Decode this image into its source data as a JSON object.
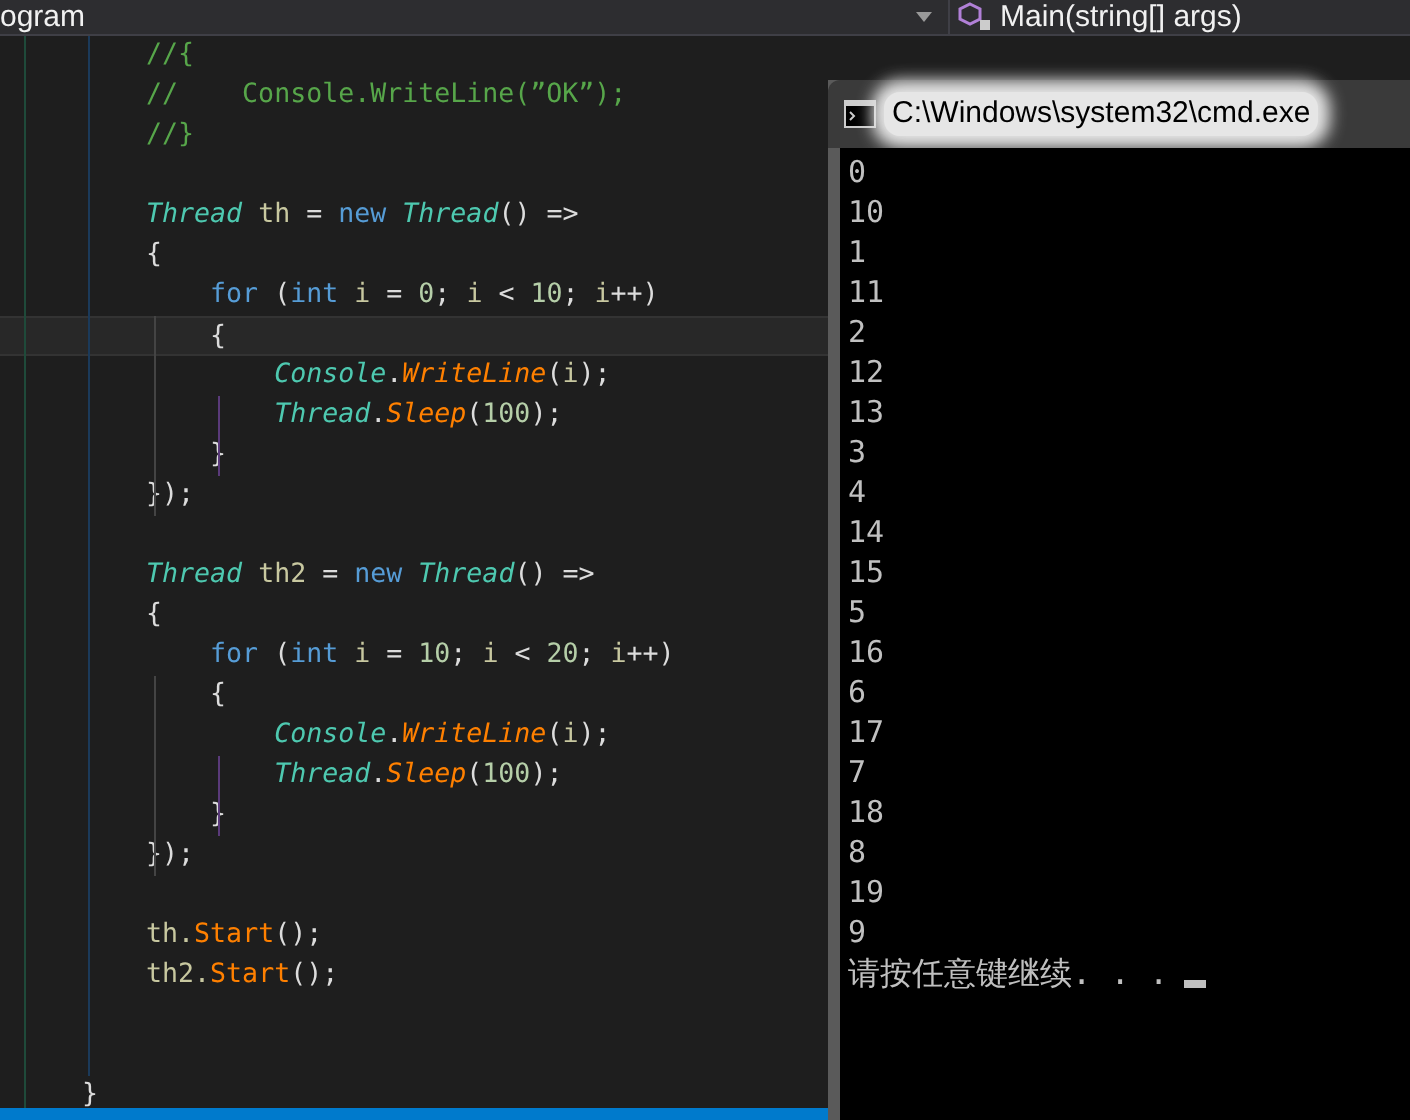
{
  "tab_bar": {
    "file_dropdown": "ogram",
    "member_dropdown": "Main(string[] args)"
  },
  "code_lines": [
    {
      "current": false,
      "tokens": [
        {
          "kind": "comment",
          "text": "    //{"
        }
      ]
    },
    {
      "current": false,
      "tokens": [
        {
          "kind": "comment",
          "text": "    //    Console.WriteLine(”OK”);"
        }
      ]
    },
    {
      "current": false,
      "tokens": [
        {
          "kind": "comment",
          "text": "    //}"
        }
      ]
    },
    {
      "current": false
    },
    {
      "current": false,
      "tokens": [
        {
          "kind": "type",
          "text": "    Thread"
        },
        {
          "kind": "var",
          "text": " th"
        },
        {
          "kind": "plain",
          "text": " = "
        },
        {
          "kind": "keyword",
          "text": "new"
        },
        {
          "kind": "type",
          "text": " Thread"
        },
        {
          "kind": "plain",
          "text": "() =>"
        }
      ]
    },
    {
      "current": false,
      "tokens": [
        {
          "kind": "plain",
          "text": "    {"
        }
      ]
    },
    {
      "current": false,
      "tokens": [
        {
          "kind": "keyword",
          "text": "        for"
        },
        {
          "kind": "plain",
          "text": " ("
        },
        {
          "kind": "keyword",
          "text": "int"
        },
        {
          "kind": "var",
          "text": " i"
        },
        {
          "kind": "plain",
          "text": " = "
        },
        {
          "kind": "number",
          "text": "0"
        },
        {
          "kind": "plain",
          "text": "; "
        },
        {
          "kind": "var",
          "text": "i"
        },
        {
          "kind": "plain",
          "text": " < "
        },
        {
          "kind": "number",
          "text": "10"
        },
        {
          "kind": "plain",
          "text": "; "
        },
        {
          "kind": "var",
          "text": "i"
        },
        {
          "kind": "plain",
          "text": "++)"
        }
      ]
    },
    {
      "current": true,
      "tokens": [
        {
          "kind": "plain",
          "text": "        {"
        }
      ]
    },
    {
      "current": false,
      "tokens": [
        {
          "kind": "type",
          "text": "            Console"
        },
        {
          "kind": "plain",
          "text": "."
        },
        {
          "kind": "method",
          "text": "WriteLine"
        },
        {
          "kind": "plain",
          "text": "("
        },
        {
          "kind": "var",
          "text": "i"
        },
        {
          "kind": "plain",
          "text": ");"
        }
      ]
    },
    {
      "current": false,
      "tokens": [
        {
          "kind": "type",
          "text": "            Thread"
        },
        {
          "kind": "plain",
          "text": "."
        },
        {
          "kind": "method",
          "text": "Sleep"
        },
        {
          "kind": "plain",
          "text": "("
        },
        {
          "kind": "number",
          "text": "100"
        },
        {
          "kind": "plain",
          "text": ");"
        }
      ]
    },
    {
      "current": false,
      "tokens": [
        {
          "kind": "plain",
          "text": "        }"
        }
      ]
    },
    {
      "current": false,
      "tokens": [
        {
          "kind": "plain",
          "text": "    });"
        }
      ]
    },
    {
      "current": false
    },
    {
      "current": false,
      "tokens": [
        {
          "kind": "type",
          "text": "    Thread"
        },
        {
          "kind": "var",
          "text": " th2"
        },
        {
          "kind": "plain",
          "text": " = "
        },
        {
          "kind": "keyword",
          "text": "new"
        },
        {
          "kind": "type",
          "text": " Thread"
        },
        {
          "kind": "plain",
          "text": "() =>"
        }
      ]
    },
    {
      "current": false,
      "tokens": [
        {
          "kind": "plain",
          "text": "    {"
        }
      ]
    },
    {
      "current": false,
      "tokens": [
        {
          "kind": "keyword",
          "text": "        for"
        },
        {
          "kind": "plain",
          "text": " ("
        },
        {
          "kind": "keyword",
          "text": "int"
        },
        {
          "kind": "var",
          "text": " i"
        },
        {
          "kind": "plain",
          "text": " = "
        },
        {
          "kind": "number",
          "text": "10"
        },
        {
          "kind": "plain",
          "text": "; "
        },
        {
          "kind": "var",
          "text": "i"
        },
        {
          "kind": "plain",
          "text": " < "
        },
        {
          "kind": "number",
          "text": "20"
        },
        {
          "kind": "plain",
          "text": "; "
        },
        {
          "kind": "var",
          "text": "i"
        },
        {
          "kind": "plain",
          "text": "++)"
        }
      ]
    },
    {
      "current": false,
      "tokens": [
        {
          "kind": "plain",
          "text": "        {"
        }
      ]
    },
    {
      "current": false,
      "tokens": [
        {
          "kind": "type",
          "text": "            Console"
        },
        {
          "kind": "plain",
          "text": "."
        },
        {
          "kind": "method",
          "text": "WriteLine"
        },
        {
          "kind": "plain",
          "text": "("
        },
        {
          "kind": "var",
          "text": "i"
        },
        {
          "kind": "plain",
          "text": ");"
        }
      ]
    },
    {
      "current": false,
      "tokens": [
        {
          "kind": "type",
          "text": "            Thread"
        },
        {
          "kind": "plain",
          "text": "."
        },
        {
          "kind": "method",
          "text": "Sleep"
        },
        {
          "kind": "plain",
          "text": "("
        },
        {
          "kind": "number",
          "text": "100"
        },
        {
          "kind": "plain",
          "text": ");"
        }
      ]
    },
    {
      "current": false,
      "tokens": [
        {
          "kind": "plain",
          "text": "        }"
        }
      ]
    },
    {
      "current": false,
      "tokens": [
        {
          "kind": "plain",
          "text": "    });"
        }
      ]
    },
    {
      "current": false
    },
    {
      "current": false,
      "tokens": [
        {
          "kind": "var",
          "text": "    th."
        },
        {
          "kind": "call",
          "text": "Start"
        },
        {
          "kind": "plain",
          "text": "();"
        }
      ]
    },
    {
      "current": false,
      "tokens": [
        {
          "kind": "var",
          "text": "    th2."
        },
        {
          "kind": "call",
          "text": "Start"
        },
        {
          "kind": "plain",
          "text": "();"
        }
      ]
    },
    {
      "current": false
    },
    {
      "current": false
    },
    {
      "current": false,
      "tokens": [
        {
          "kind": "plain",
          "text": "}"
        }
      ]
    }
  ],
  "console_window": {
    "title": "C:\\Windows\\system32\\cmd.exe",
    "output": [
      "0",
      "10",
      "1",
      "11",
      "2",
      "12",
      "13",
      "3",
      "4",
      "14",
      "15",
      "5",
      "16",
      "6",
      "17",
      "7",
      "18",
      "8",
      "19",
      "9"
    ],
    "prompt": "请按任意键继续. . ."
  }
}
